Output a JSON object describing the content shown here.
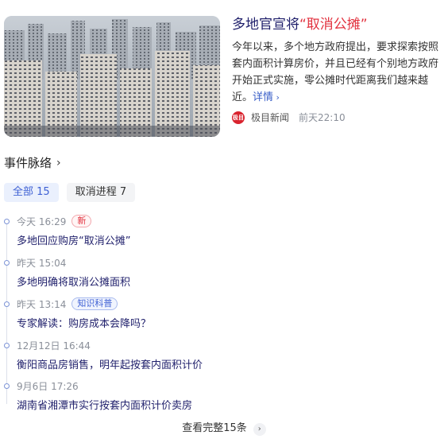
{
  "news": {
    "title_prefix": "多地官宣将",
    "title_highlight": "“取消公摊”",
    "body": "今年以来，多个地方政府提出，要求探索按照套内面积计算房价，并且已经有个别地方政府开始正式实施，零公摊时代距离我们越来越近。",
    "more_label": "详情",
    "more_icon": "chevron-right-icon",
    "source_logo_text": "极目",
    "source_name": "极目新闻",
    "time": "前天22:10",
    "colors": {
      "highlight": "#e2323f",
      "link": "#3a5fc8"
    }
  },
  "section": {
    "title": "事件脉络",
    "icon": "chevron-right-icon"
  },
  "tabs": [
    {
      "label": "全部",
      "count": "15",
      "active": true
    },
    {
      "label": "取消进程",
      "count": "7",
      "active": false
    }
  ],
  "timeline": [
    {
      "time": "今天 16:29",
      "badge": "新",
      "badge_type": "new",
      "text": "多地回应购房“取消公摊”"
    },
    {
      "time": "昨天 15:04",
      "badge": "",
      "badge_type": "",
      "text": "多地明确将取消公摊面积"
    },
    {
      "time": "昨天 13:14",
      "badge": "知识科普",
      "badge_type": "kp",
      "text": "专家解读：购房成本会降吗？"
    },
    {
      "time": "12月12日 16:44",
      "badge": "",
      "badge_type": "",
      "text": "衡阳商品房销售，明年起按套内面积计价"
    },
    {
      "time": "9月6日 17:26",
      "badge": "",
      "badge_type": "",
      "text": "湖南省湘潭市实行按套内面积计价卖房"
    }
  ],
  "view_all": {
    "label": "查看完整15条",
    "icon": "chevron-right-icon"
  }
}
